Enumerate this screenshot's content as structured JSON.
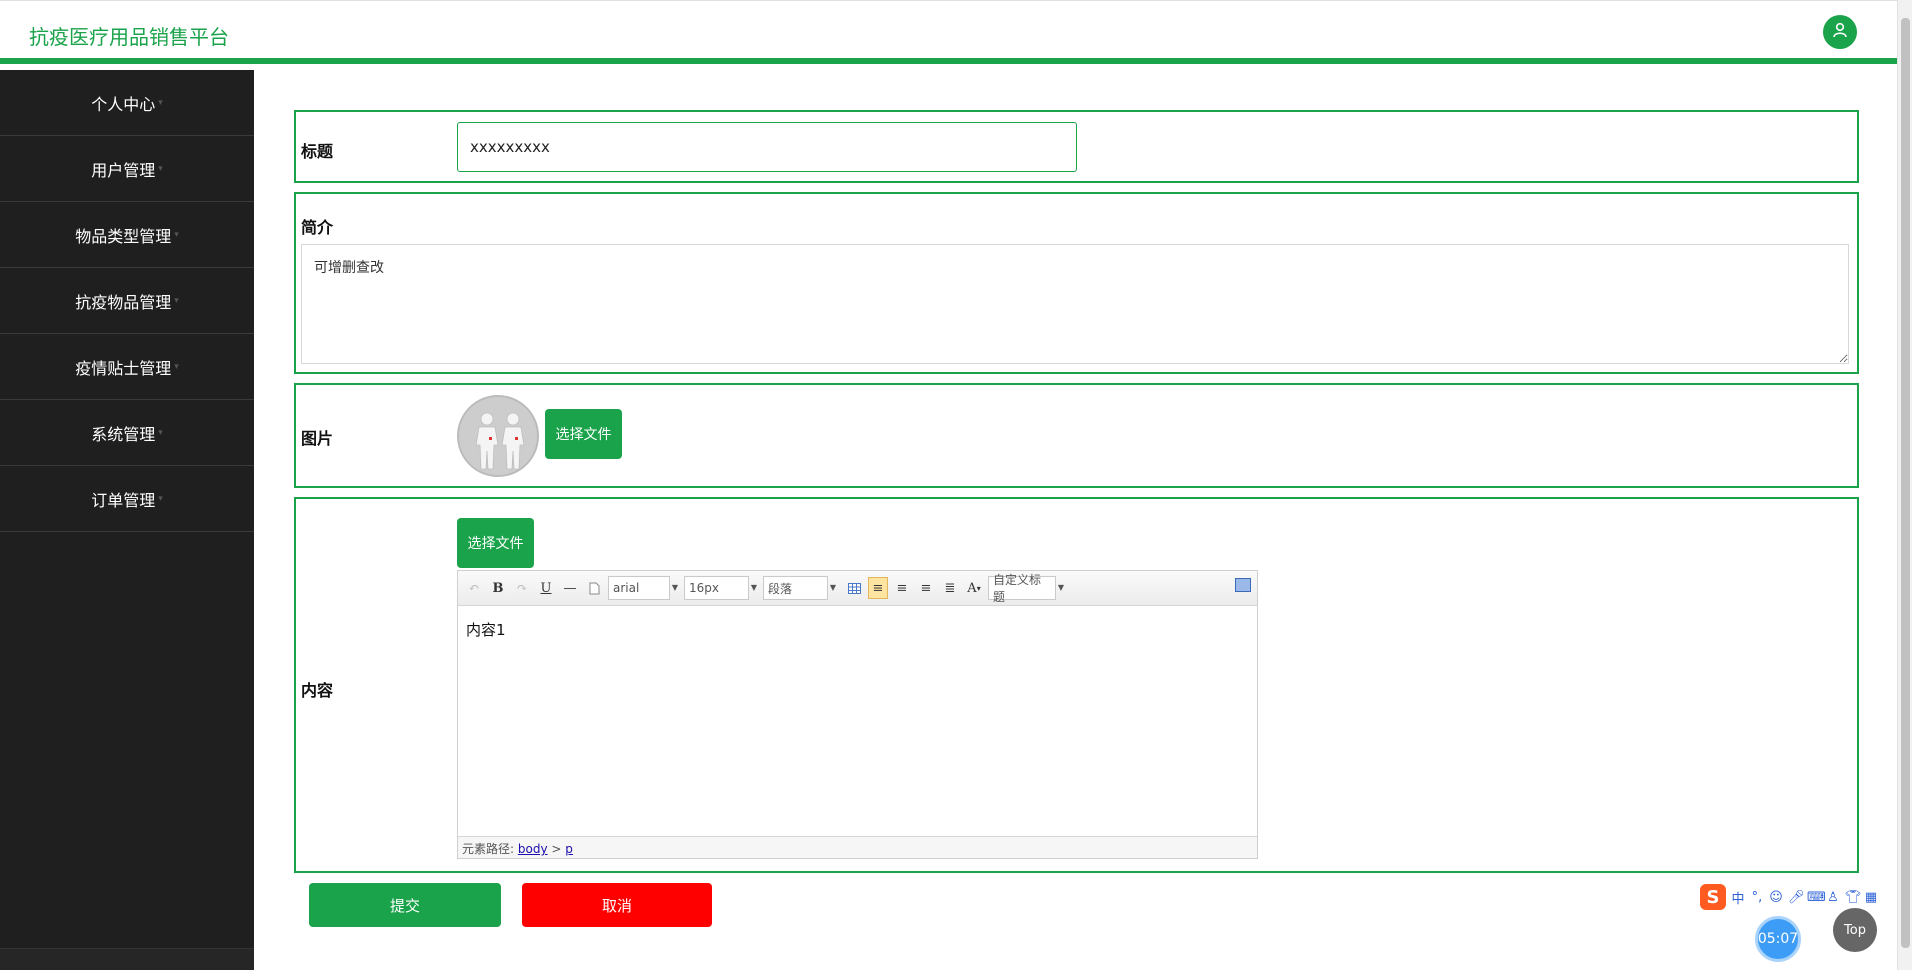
{
  "header": {
    "brand": "抗疫医疗用品销售平台",
    "avatar_icon": "user-icon"
  },
  "sidebar": {
    "items": [
      {
        "label": "个人中心"
      },
      {
        "label": "用户管理"
      },
      {
        "label": "物品类型管理"
      },
      {
        "label": "抗疫物品管理"
      },
      {
        "label": "疫情贴士管理"
      },
      {
        "label": "系统管理"
      },
      {
        "label": "订单管理"
      }
    ]
  },
  "form": {
    "title_label": "标题",
    "title_value": "xxxxxxxxx",
    "intro_label": "简介",
    "intro_value": "可增删查改",
    "image_label": "图片",
    "image_button": "选择文件",
    "content_label": "内容",
    "content_button": "选择文件",
    "editor": {
      "font_family": "arial",
      "font_size": "16px",
      "paragraph": "段落",
      "custom_heading": "自定义标题",
      "body_text": "内容1",
      "path_label": "元素路径:",
      "path_body": "body",
      "path_sep": ">",
      "path_p": "p"
    },
    "submit_label": "提交",
    "cancel_label": "取消"
  },
  "colors": {
    "accent": "#1aa34a",
    "danger": "#ff0000",
    "sidebar_bg": "#1f1f1f"
  },
  "floaters": {
    "ime_logo": "S",
    "ime_lang": "中",
    "clock": "05:07",
    "top_label": "Top"
  }
}
